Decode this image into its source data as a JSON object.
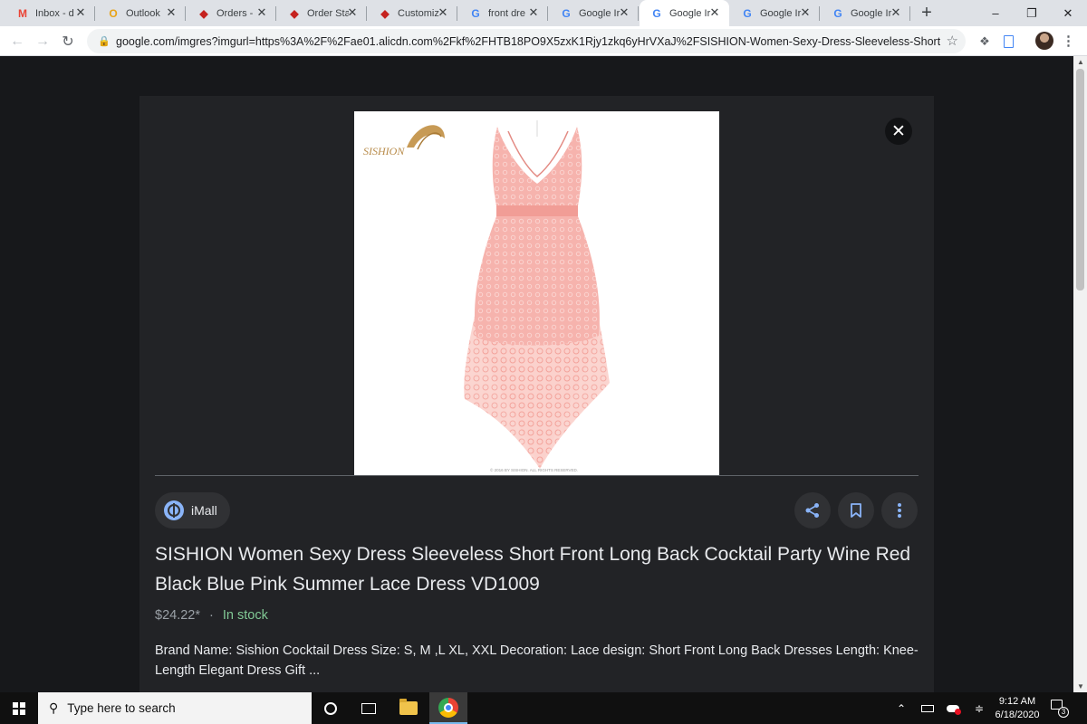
{
  "tabs": [
    {
      "label": "Inbox - d",
      "icon": "gmail-icon",
      "glyph": "M",
      "color": "#ea4335"
    },
    {
      "label": "Outlook",
      "icon": "outlook-icon",
      "glyph": "O",
      "color": "#e8a317"
    },
    {
      "label": "Orders -",
      "icon": "order-doc-icon",
      "glyph": "◆",
      "color": "#c5221f"
    },
    {
      "label": "Order Sta",
      "icon": "order-doc-icon",
      "glyph": "◆",
      "color": "#c5221f"
    },
    {
      "label": "Customiz",
      "icon": "order-doc-icon",
      "glyph": "◆",
      "color": "#c5221f"
    },
    {
      "label": "front dre",
      "icon": "google-icon",
      "glyph": "G",
      "color": "#4285f4"
    },
    {
      "label": "Google Ir",
      "icon": "google-icon",
      "glyph": "G",
      "color": "#4285f4"
    },
    {
      "label": "Google Ir",
      "icon": "google-icon",
      "glyph": "G",
      "color": "#4285f4",
      "active": true
    },
    {
      "label": "Google Ir",
      "icon": "google-icon",
      "glyph": "G",
      "color": "#4285f4"
    },
    {
      "label": "Google Ir",
      "icon": "google-icon",
      "glyph": "G",
      "color": "#4285f4"
    }
  ],
  "toolbar": {
    "url": "google.com/imgres?imgurl=https%3A%2F%2Fae01.alicdn.com%2Fkf%2FHTB18PO9X5zxK1Rjy1zkq6yHrVXaJ%2FSISHION-Women-Sexy-Dress-Sleeveless-Short-Front-..."
  },
  "image": {
    "brand_logo": "SISHION",
    "copyright": "© 2016 BY SISHION. ALL RIGHTS RESERVED."
  },
  "result": {
    "source": "iMall",
    "title": "SISHION Women Sexy Dress Sleeveless Short Front Long Back Cocktail Party Wine Red Black Blue Pink Summer Lace Dress VD1009",
    "price": "$24.22*",
    "separator": "·",
    "stock": "In stock",
    "description": "Brand Name: Sishion Cocktail Dress Size: S, M ,L XL, XXL Decoration: Lace design: Short Front Long Back Dresses Length: Knee-Length Elegant Dress Gift ..."
  },
  "taskbar": {
    "search_placeholder": "Type here to search",
    "time": "9:12 AM",
    "date": "6/18/2020",
    "notification_count": "3"
  }
}
